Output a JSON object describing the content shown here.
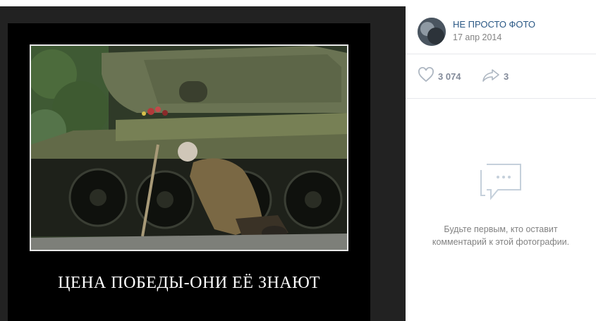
{
  "post": {
    "author": "НЕ ПРОСТО ФОТО",
    "date": "17 апр 2014",
    "avatar_icon": "group-avatar"
  },
  "actions": {
    "likes": "3 074",
    "shares": "3",
    "like_icon": "heart-icon",
    "share_icon": "share-arrow-icon"
  },
  "photo": {
    "caption": "ЦЕНА ПОБЕДЫ-ОНИ ЕЁ ЗНАЮТ"
  },
  "comments": {
    "empty_line1": "Будьте первым, кто оставит",
    "empty_line2": "комментарий к этой фотографии.",
    "empty_icon": "comment-bubble-icon"
  },
  "colors": {
    "link": "#2a5885",
    "muted": "#828282",
    "viewer_bg": "#222222",
    "icon_gray": "#aeb7c2",
    "icon_light": "#c5d0db"
  }
}
